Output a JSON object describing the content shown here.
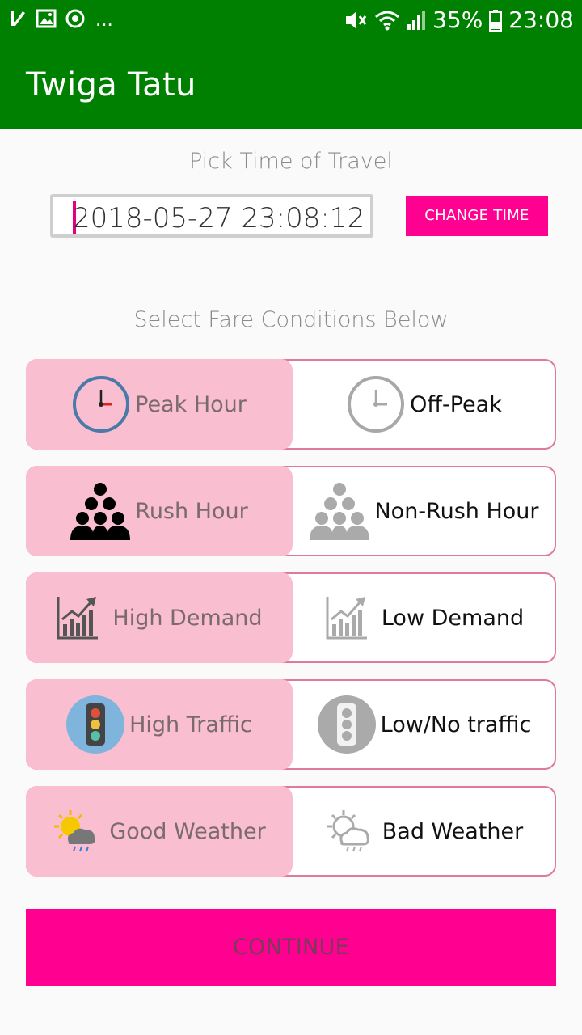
{
  "status_bar": {
    "battery": "35%",
    "time": "23:08",
    "more": "..."
  },
  "app_bar": {
    "title": "Twiga Tatu"
  },
  "travel": {
    "label": "Pick Time of Travel",
    "datetime": "2018-05-27 23:08:12",
    "change_label": "CHANGE TIME"
  },
  "conditions": {
    "label": "Select Fare Conditions Below",
    "rows": [
      {
        "left": "Peak Hour",
        "right": "Off-Peak",
        "left_icon": "clock-icon",
        "right_icon": "clock-icon"
      },
      {
        "left": "Rush Hour",
        "right": "Non-Rush Hour",
        "left_icon": "crowd-icon",
        "right_icon": "crowd-icon"
      },
      {
        "left": "High Demand",
        "right": "Low Demand",
        "left_icon": "chart-icon",
        "right_icon": "chart-icon"
      },
      {
        "left": "High Traffic",
        "right": "Low/No traffic",
        "left_icon": "traffic-light-icon",
        "right_icon": "traffic-light-icon"
      },
      {
        "left": "Good Weather",
        "right": "Bad Weather",
        "left_icon": "sun-cloud-icon",
        "right_icon": "sun-cloud-icon"
      }
    ],
    "selected": "left"
  },
  "continue_label": "CONTINUE",
  "colors": {
    "app_bar": "#008000",
    "accent": "#ff0090",
    "selected_option": "#f9bed0",
    "toggle_border": "#e07a9a"
  }
}
